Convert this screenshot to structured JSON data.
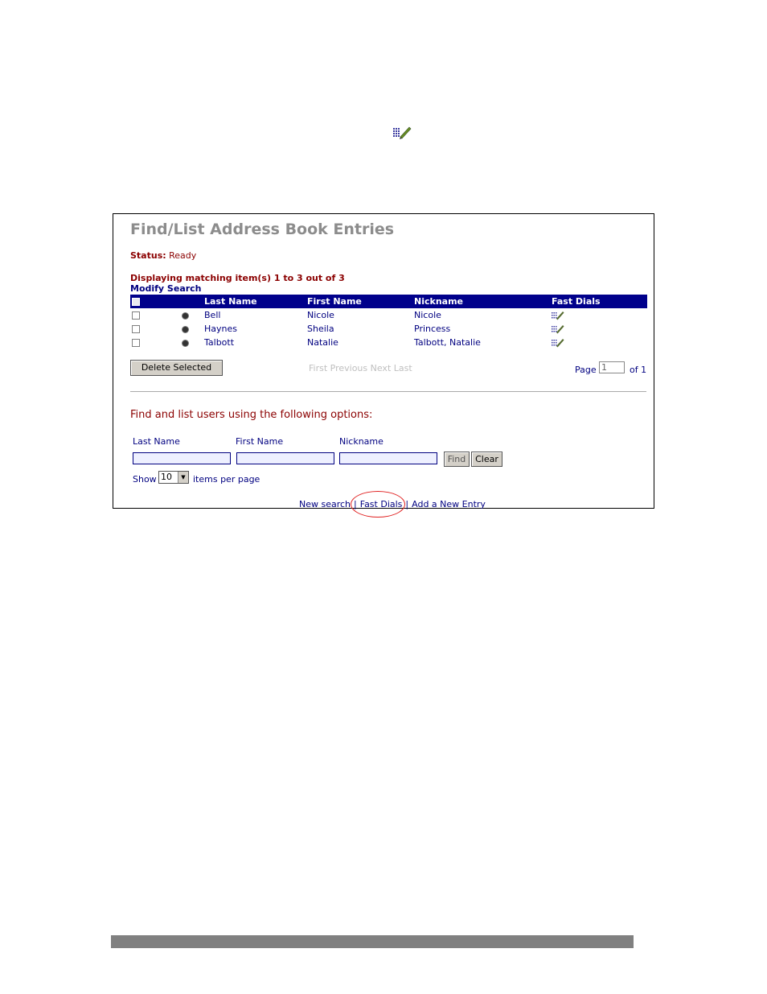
{
  "icons": {
    "top": "fast-dials-icon",
    "row": "fast-dials-icon"
  },
  "panel": {
    "title": "Find/List Address Book Entries",
    "status_label": "Status:",
    "status_value": "Ready",
    "display_info": "Displaying matching item(s) 1 to 3 out of 3",
    "modify_search": "Modify Search"
  },
  "table": {
    "headers": [
      "",
      "",
      "Last Name",
      "First Name",
      "Nickname",
      "Fast Dials"
    ],
    "rows": [
      {
        "last": "Bell",
        "first": "Nicole",
        "nick": "Nicole"
      },
      {
        "last": "Haynes",
        "first": "Sheila",
        "nick": "Princess"
      },
      {
        "last": "Talbott",
        "first": "Natalie",
        "nick": "Talbott, Natalie"
      }
    ]
  },
  "actions": {
    "delete_selected": "Delete Selected",
    "pager": "First Previous Next Last",
    "page_label": "Page",
    "page_value": "1",
    "of_label": "of 1"
  },
  "find": {
    "title": "Find and list users using the following options:",
    "last_name_label": "Last Name",
    "first_name_label": "First Name",
    "nickname_label": "Nickname",
    "find_button": "Find",
    "clear_button": "Clear",
    "show_label": "Show",
    "show_value": "10",
    "items_per_page": "items per page"
  },
  "links": {
    "new_search": "New search",
    "separator": "|",
    "fast_dials": "Fast Dials",
    "add_entry": "Add a New Entry"
  },
  "colors": {
    "header_bg": "#00008b",
    "status_red": "#8b0000",
    "link_blue": "#000080",
    "highlight": "#e02020"
  }
}
